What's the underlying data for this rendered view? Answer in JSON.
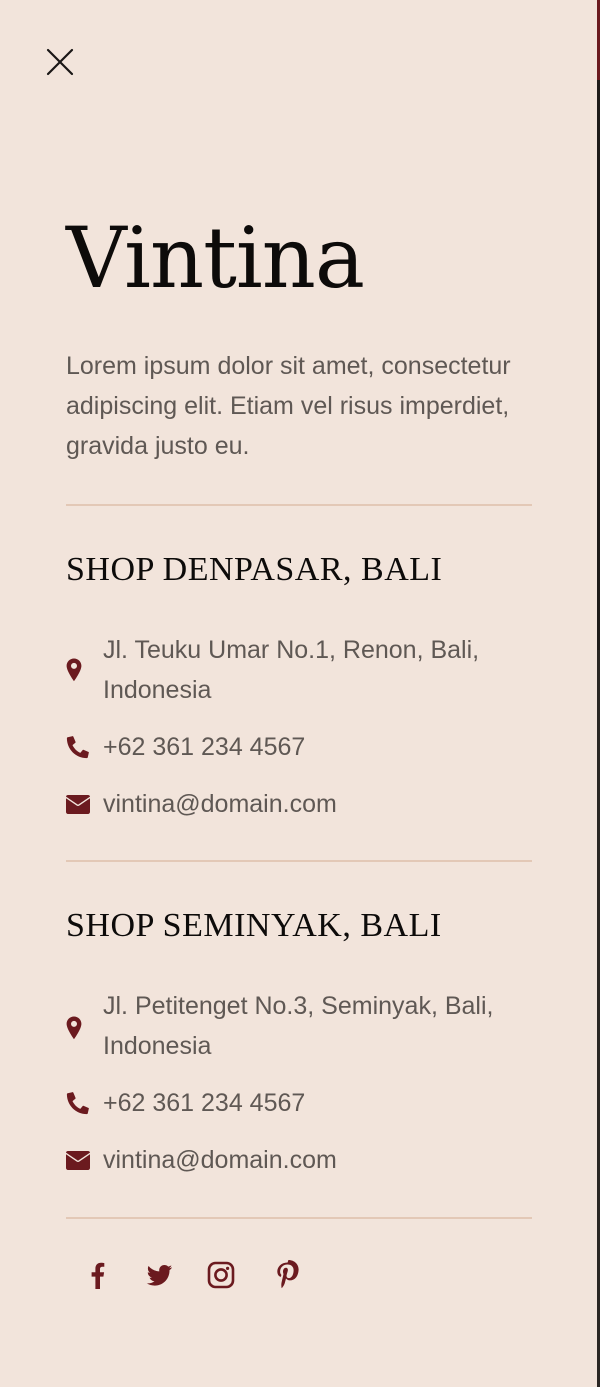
{
  "brand": {
    "name": "Vintina",
    "description": "Lorem ipsum dolor sit amet, consectetur adipiscing elit. Etiam vel risus imperdiet, gravida justo eu."
  },
  "shops": [
    {
      "title": "SHOP DENPASAR, BALI",
      "address": "Jl. Teuku Umar No.1, Renon, Bali, Indonesia",
      "phone": "+62 361 234 4567",
      "email": "vintina@domain.com"
    },
    {
      "title": "SHOP SEMINYAK, BALI",
      "address": "Jl. Petitenget No.3, Seminyak, Bali, Indonesia",
      "phone": "+62 361 234 4567",
      "email": "vintina@domain.com"
    }
  ],
  "social": [
    {
      "icon": "facebook-icon"
    },
    {
      "icon": "twitter-icon"
    },
    {
      "icon": "instagram-icon"
    },
    {
      "icon": "pinterest-icon"
    }
  ],
  "colors": {
    "background": "#f2e4db",
    "accent": "#6b1a1f",
    "text": "#5f5854",
    "heading": "#0d0b0a",
    "divider": "#e3c8b6"
  }
}
